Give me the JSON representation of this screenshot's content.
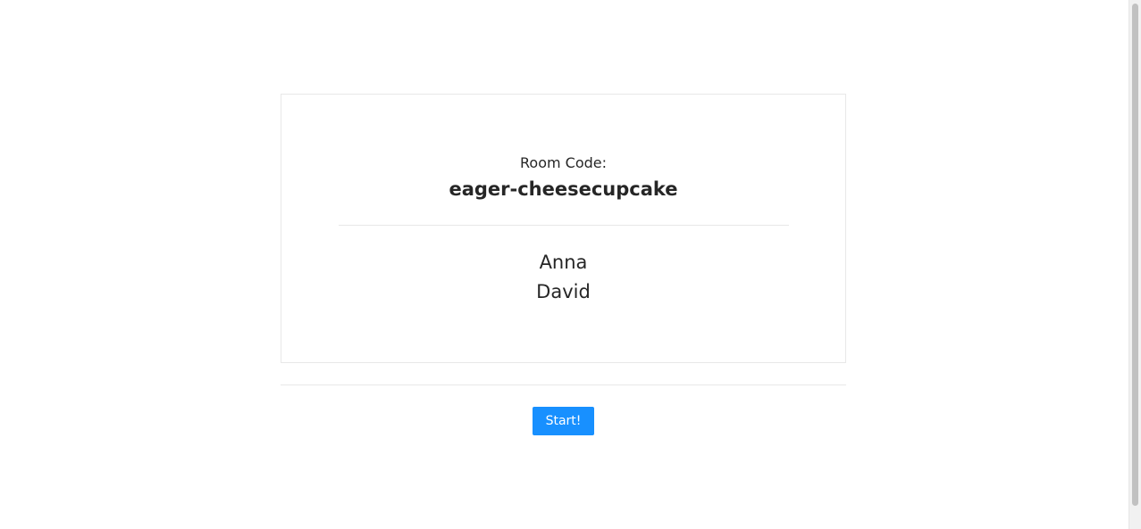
{
  "room": {
    "label": "Room Code:",
    "code": "eager-cheesecupcake"
  },
  "players": [
    {
      "name": "Anna"
    },
    {
      "name": "David"
    }
  ],
  "actions": {
    "start_label": "Start!"
  },
  "colors": {
    "primary": "#1890ff",
    "border": "#e8e8e8",
    "text": "#262626"
  }
}
